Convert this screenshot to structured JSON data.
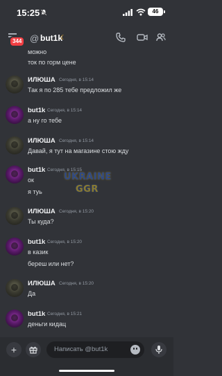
{
  "status_bar": {
    "time": "15:25",
    "battery": "46"
  },
  "header": {
    "unread_count": "344",
    "at_symbol": "@",
    "channel_name": "but1k",
    "moon": "☾"
  },
  "chat": {
    "continuation": [
      "можно",
      "ток по горм цене"
    ],
    "messages": [
      {
        "author": "ИЛЮША",
        "avatar": "ilyusha",
        "time": "Сегодня, в 15:14",
        "lines": [
          "Так я по 285 тебе предложил же"
        ]
      },
      {
        "author": "but1k",
        "avatar": "but1k",
        "time": "Сегодня, в 15:14",
        "lines": [
          "а ну го тебе"
        ]
      },
      {
        "author": "ИЛЮША",
        "avatar": "ilyusha",
        "time": "Сегодня, в 15:14",
        "lines": [
          "Давай, я тут на магазине стою жду"
        ]
      },
      {
        "author": "but1k",
        "avatar": "but1k",
        "time": "Сегодня, в 15:15",
        "lines": [
          "ок",
          "я туь"
        ]
      },
      {
        "author": "ИЛЮША",
        "avatar": "ilyusha",
        "time": "Сегодня, в 15:20",
        "lines": [
          "Ты куда?"
        ]
      },
      {
        "author": "but1k",
        "avatar": "but1k",
        "time": "Сегодня, в 15:20",
        "lines": [
          "в казик",
          "береш или нет?"
        ]
      },
      {
        "author": "ИЛЮША",
        "avatar": "ilyusha",
        "time": "Сегодня, в 15:20",
        "lines": [
          "Да"
        ]
      },
      {
        "author": "but1k",
        "avatar": "but1k",
        "time": "Сегодня, в 15:21",
        "lines": [
          "деньги кидац"
        ]
      }
    ]
  },
  "watermark": {
    "line1": "UKRAINE",
    "line2": "GGR"
  },
  "composer": {
    "plus": "+",
    "placeholder": "Написать @but1k"
  },
  "colors": {
    "background": "#313338",
    "composer": "#2b2d31",
    "badge": "#f23f43",
    "muted_text": "#949ba4"
  },
  "icons": [
    "mute-bell-icon",
    "signal-icon",
    "wifi-icon",
    "back-arrow-icon",
    "phone-call-icon",
    "video-camera-icon",
    "members-icon",
    "gift-icon",
    "emoji-icon",
    "microphone-icon"
  ]
}
